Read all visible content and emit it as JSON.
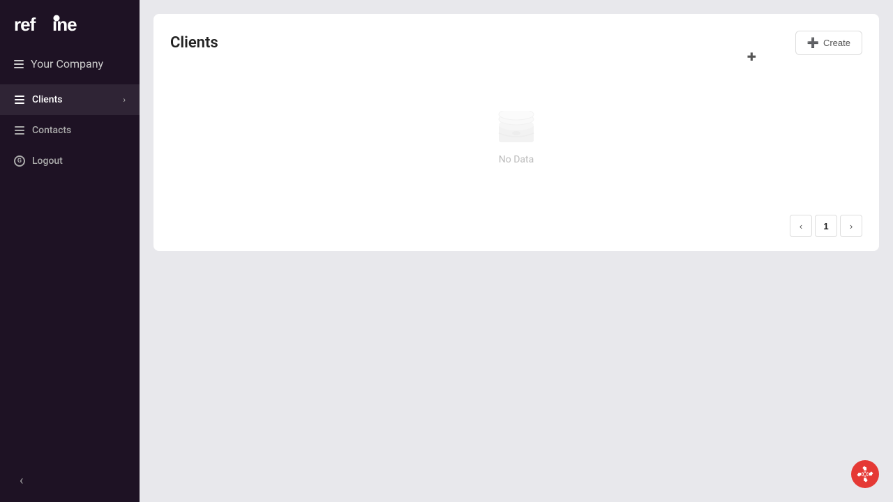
{
  "app": {
    "logo": "refine"
  },
  "sidebar": {
    "company": {
      "name": "Your Company"
    },
    "items": [
      {
        "id": "clients",
        "label": "Clients",
        "active": true,
        "has_chevron": true,
        "icon": "list-icon"
      },
      {
        "id": "contacts",
        "label": "Contacts",
        "active": false,
        "has_chevron": false,
        "icon": "list-icon"
      },
      {
        "id": "logout",
        "label": "Logout",
        "active": false,
        "has_chevron": false,
        "icon": "logout-icon"
      }
    ],
    "collapse_button": "‹"
  },
  "main": {
    "page_title": "Clients",
    "create_button_label": "Create",
    "no_data_text": "No Data"
  },
  "pagination": {
    "prev_label": "‹",
    "next_label": "›",
    "current_page": "1"
  }
}
